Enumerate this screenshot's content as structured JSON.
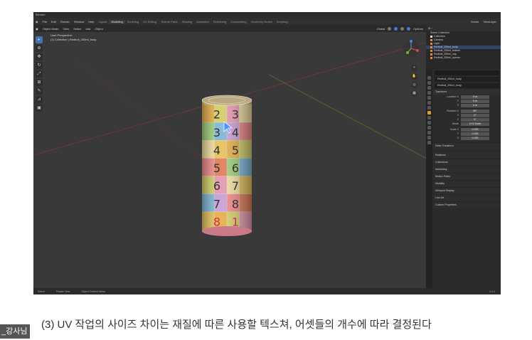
{
  "window": {
    "title": "Blender"
  },
  "menubar": {
    "menus": [
      "File",
      "Edit",
      "Render",
      "Window",
      "Help"
    ],
    "workspaces": [
      "Layout",
      "Modeling",
      "Sculpting",
      "UV Editing",
      "Texture Paint",
      "Shading",
      "Animation",
      "Rendering",
      "Compositing",
      "Geometry Nodes",
      "Scripting"
    ],
    "active_workspace": "Modeling",
    "scene": "Scene",
    "view_layer": "ViewLayer"
  },
  "viewport_header": {
    "mode": "Object Mode",
    "menus": [
      "View",
      "Select",
      "Add",
      "Object"
    ],
    "transform": "Global",
    "options": "Options"
  },
  "viewport": {
    "perspective": "User Perspective",
    "collection_path": "(1) Collection | Redbull_250ml_body",
    "can_numbers": [
      "2",
      "3",
      "3",
      "4",
      "4",
      "5",
      "5",
      "6",
      "6",
      "7",
      "7",
      "8",
      "8",
      "1"
    ]
  },
  "outliner": {
    "title": "Scene Collection",
    "items": [
      "Collection",
      "Camera",
      "Light",
      "Redbull_250ml_body",
      "Redbull_250ml_bottom",
      "Redbull_250ml_cap",
      "Redbull_250ml_opener"
    ]
  },
  "properties": {
    "object_name": "Redbull_250ml_body",
    "data_name": "Redbull_250ml_body",
    "transform_header": "Transform",
    "location": {
      "label": "Location X",
      "x": "0 m",
      "y": "0 m",
      "z": "0 m"
    },
    "rotation": {
      "label": "Rotation X",
      "x": "90°",
      "y": "0°",
      "z": "0°"
    },
    "mode": {
      "label": "Mode",
      "value": "XYZ Euler"
    },
    "scale": {
      "label": "Scale X",
      "x": "0.053",
      "y": "0.053",
      "z": "0.053"
    },
    "axis_labels": [
      "Y",
      "Z"
    ],
    "delta": "Delta Transform",
    "panels": [
      "Relations",
      "Collections",
      "Instancing",
      "Motion Paths",
      "Visibility",
      "Viewport Display",
      "Line Art",
      "Custom Properties"
    ]
  },
  "statusbar": {
    "items": [
      "Select",
      "Rotate View",
      "Object Context Menu"
    ],
    "version": "3.4.1"
  },
  "caption": "(3) UV 작업의 사이즈 차이는 재질에 따른 사용할 텍스쳐, 어셋들의 개수에 따라 결정된다",
  "watermark": "_강사님"
}
